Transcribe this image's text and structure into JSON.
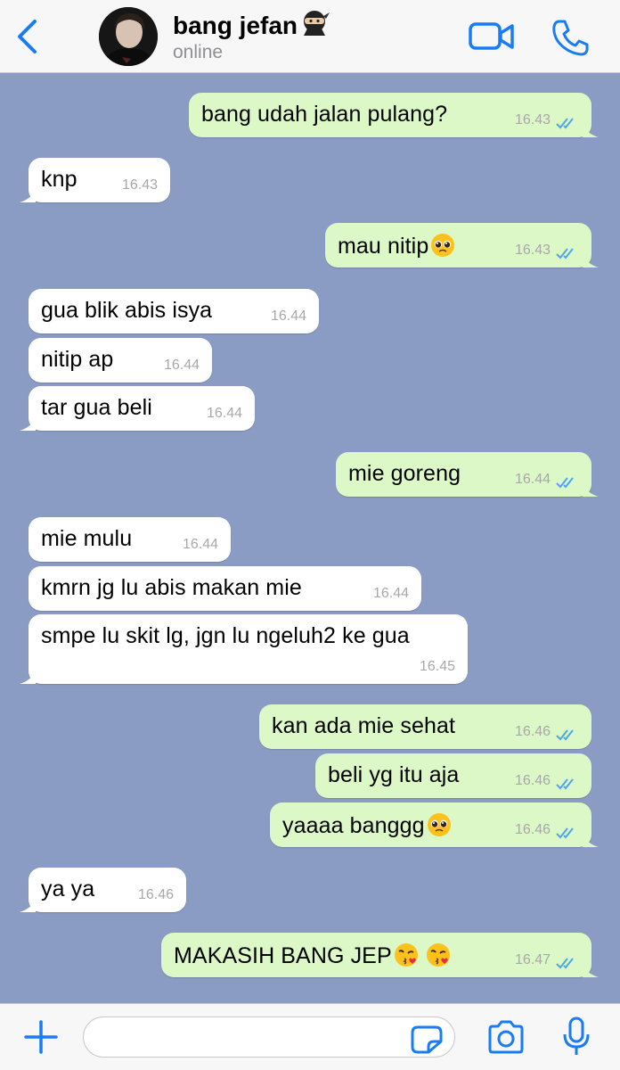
{
  "header": {
    "back_icon": "chevron-left-icon",
    "contact_name": "bang jefan",
    "contact_emoji": "ninja",
    "status": "online",
    "video_icon": "video-camera-icon",
    "call_icon": "phone-icon",
    "accent_color": "#1a7cf5"
  },
  "chat": {
    "background_color": "#8a9cc4",
    "outgoing_color": "#dbf8c6",
    "incoming_color": "#ffffff",
    "messages": [
      {
        "dir": "out",
        "text": "bang udah jalan pulang?",
        "time": "16.43",
        "status": "read"
      },
      {
        "dir": "in",
        "text": "knp",
        "time": "16.43"
      },
      {
        "dir": "out",
        "text": "mau nitip",
        "emoji": "pleading-face",
        "time": "16.43",
        "status": "read"
      },
      {
        "dir": "in",
        "text": "gua blik abis isya",
        "time": "16.44"
      },
      {
        "dir": "in",
        "text": "nitip ap",
        "time": "16.44"
      },
      {
        "dir": "in",
        "text": "tar gua beli",
        "time": "16.44"
      },
      {
        "dir": "out",
        "text": "mie goreng",
        "time": "16.44",
        "status": "read"
      },
      {
        "dir": "in",
        "text": "mie mulu",
        "time": "16.44"
      },
      {
        "dir": "in",
        "text": "kmrn jg lu abis makan mie",
        "time": "16.44"
      },
      {
        "dir": "in",
        "text": "smpe lu skit lg, jgn lu ngeluh2 ke gua",
        "time": "16.45"
      },
      {
        "dir": "out",
        "text": "kan ada mie sehat",
        "time": "16.46",
        "status": "read"
      },
      {
        "dir": "out",
        "text": "beli yg itu aja",
        "time": "16.46",
        "status": "read"
      },
      {
        "dir": "out",
        "text": "yaaaa banggg",
        "emoji": "pleading-face",
        "time": "16.46",
        "status": "read"
      },
      {
        "dir": "in",
        "text": "ya ya",
        "time": "16.46"
      },
      {
        "dir": "out",
        "text": "MAKASIH BANG JEP",
        "emoji2": "kissing-heart-face",
        "time": "16.47",
        "status": "read"
      }
    ]
  },
  "composer": {
    "plus_icon": "plus-icon",
    "input_value": "",
    "sticker_icon": "sticker-icon",
    "camera_icon": "camera-icon",
    "mic_icon": "microphone-icon"
  }
}
